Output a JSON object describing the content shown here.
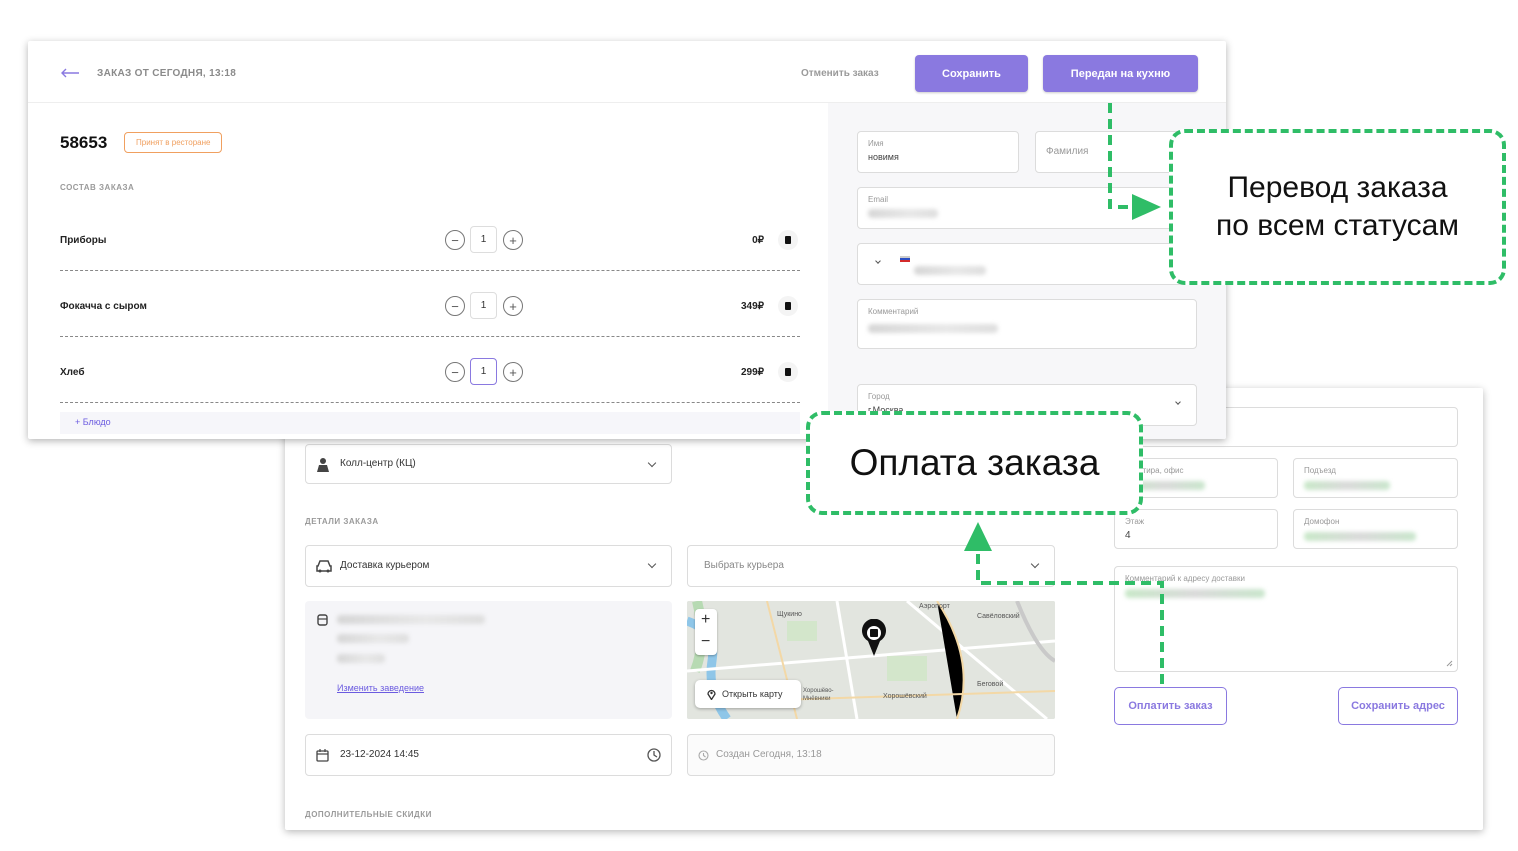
{
  "header": {
    "title": "ЗАКАЗ ОТ СЕГОДНЯ, 13:18",
    "cancel_label": "Отменить заказ",
    "save_label": "Сохранить",
    "kitchen_label": "Передан на кухню"
  },
  "order": {
    "number": "58653",
    "status": "Принят в ресторане",
    "section_label": "СОСТАВ ЗАКАЗА",
    "items": [
      {
        "name": "Приборы",
        "qty": "1",
        "price": "0₽"
      },
      {
        "name": "Фокачча с сыром",
        "qty": "1",
        "price": "349₽"
      },
      {
        "name": "Хлеб",
        "qty": "1",
        "price": "299₽"
      }
    ],
    "add_dish_label": "+  Блюдо"
  },
  "customer": {
    "name_label": "Имя",
    "name_value": "новимя",
    "surname_placeholder": "Фамилия",
    "email_label": "Email",
    "comment_label": "Комментарий",
    "city_label": "Город",
    "city_value": "г.Москва"
  },
  "address": {
    "apartment_label": "Квартира, офис",
    "entrance_label": "Подъезд",
    "floor_label": "Этаж",
    "floor_value": "4",
    "intercom_label": "Домофон",
    "comment_label": "Комментарий к адресу доставки",
    "pay_label": "Оплатить заказ",
    "save_address_label": "Сохранить адрес"
  },
  "details": {
    "source_value": "Колл-центр (КЦ)",
    "section_label": "ДЕТАЛИ ЗАКАЗА",
    "delivery_value": "Доставка курьером",
    "courier_placeholder": "Выбрать курьера",
    "change_venue_label": "Изменить заведение",
    "datetime_value": "23-12-2024 14:45",
    "created_value": "Создан Сегодня, 13:18",
    "discounts_label": "ДОПОЛНИТЕЛЬНЫЕ СКИДКИ"
  },
  "map": {
    "zoom_in": "+",
    "zoom_out": "−",
    "open_map_label": "Открыть карту",
    "places": [
      "Аэропорт",
      "Щукино",
      "Савёловский",
      "Беговой",
      "Хорошёвский",
      "Хорошёво-Мнёвники"
    ]
  },
  "callouts": {
    "statuses_line1": "Перевод заказа",
    "statuses_line2": "по всем статусам",
    "payment": "Оплата заказа"
  },
  "colors": {
    "accent": "#8a79e0",
    "callout": "#2fbd67",
    "status_badge": "#f0a060"
  }
}
